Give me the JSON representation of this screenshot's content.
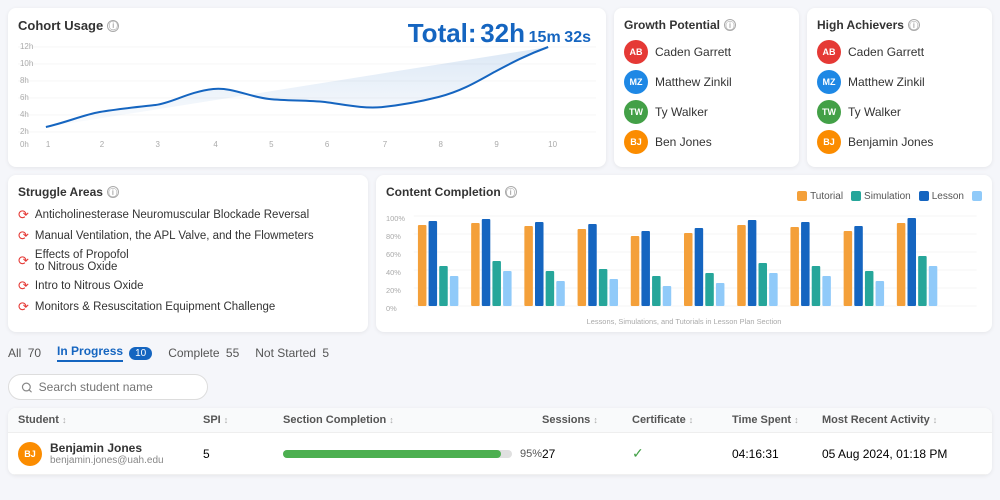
{
  "cohort": {
    "title": "Cohort Usage",
    "total_label": "Total:",
    "hours": "32h",
    "minutes": "15m",
    "seconds": "32s",
    "info_icon": "ⓘ"
  },
  "growth_potential": {
    "title": "Growth Potential",
    "info_icon": "ⓘ",
    "people": [
      {
        "initials": "AB",
        "name": "Caden Garrett",
        "avatar_class": "avatar-ab"
      },
      {
        "initials": "MZ",
        "name": "Matthew Zinkil",
        "avatar_class": "avatar-mz"
      },
      {
        "initials": "TW",
        "name": "Ty Walker",
        "avatar_class": "avatar-tw"
      },
      {
        "initials": "BJ",
        "name": "Ben Jones",
        "avatar_class": "avatar-bj"
      }
    ]
  },
  "high_achievers": {
    "title": "High Achievers",
    "info_icon": "ⓘ",
    "people": [
      {
        "initials": "AB",
        "name": "Caden Garrett",
        "avatar_class": "avatar-ab"
      },
      {
        "initials": "MZ",
        "name": "Matthew Zinkil",
        "avatar_class": "avatar-mz"
      },
      {
        "initials": "TW",
        "name": "Ty Walker",
        "avatar_class": "avatar-tw"
      },
      {
        "initials": "BJ",
        "name": "Benjamin Jones",
        "avatar_class": "avatar-bj"
      }
    ]
  },
  "struggle_areas": {
    "title": "Struggle Areas",
    "info_icon": "ⓘ",
    "items": [
      "Anticholinesterase Neuromuscular Blockade Reversal",
      "Manual Ventilation, the APL Valve, and the Flowmeters",
      "Effects of Propofol to Nitrous Oxide",
      "Intro to Nitrous Oxide",
      "Monitors & Resuscitation Equipment Challenge"
    ]
  },
  "content_completion": {
    "title": "Content Completion",
    "info_icon": "ⓘ",
    "legend": {
      "tutorial": "Tutorial",
      "simulation": "Simulation",
      "lesson": "Lesson",
      "other": ""
    },
    "x_label": "Lessons, Simulations, and Tutorials in Lesson Plan Section"
  },
  "filter": {
    "all_label": "All",
    "all_count": "70",
    "in_progress_label": "In Progress",
    "in_progress_count": "10",
    "complete_label": "Complete",
    "complete_count": "55",
    "not_started_label": "Not Started",
    "not_started_count": "5"
  },
  "search": {
    "placeholder": "Search student name"
  },
  "table": {
    "headers": {
      "student": "Student",
      "spi": "SPI",
      "section": "Section Completion",
      "sessions": "Sessions",
      "certificate": "Certificate",
      "time": "Time Spent",
      "activity": "Most Recent Activity"
    },
    "rows": [
      {
        "initials": "BJ",
        "avatar_class": "avatar-bj",
        "name": "Benjamin Jones",
        "email": "benjamin.jones@uah.edu",
        "spi": "5",
        "section_pct": 95,
        "section_pct_label": "95%",
        "sessions": "27",
        "has_certificate": true,
        "time": "04:16:31",
        "activity": "05 Aug 2024, 01:18 PM"
      }
    ]
  }
}
